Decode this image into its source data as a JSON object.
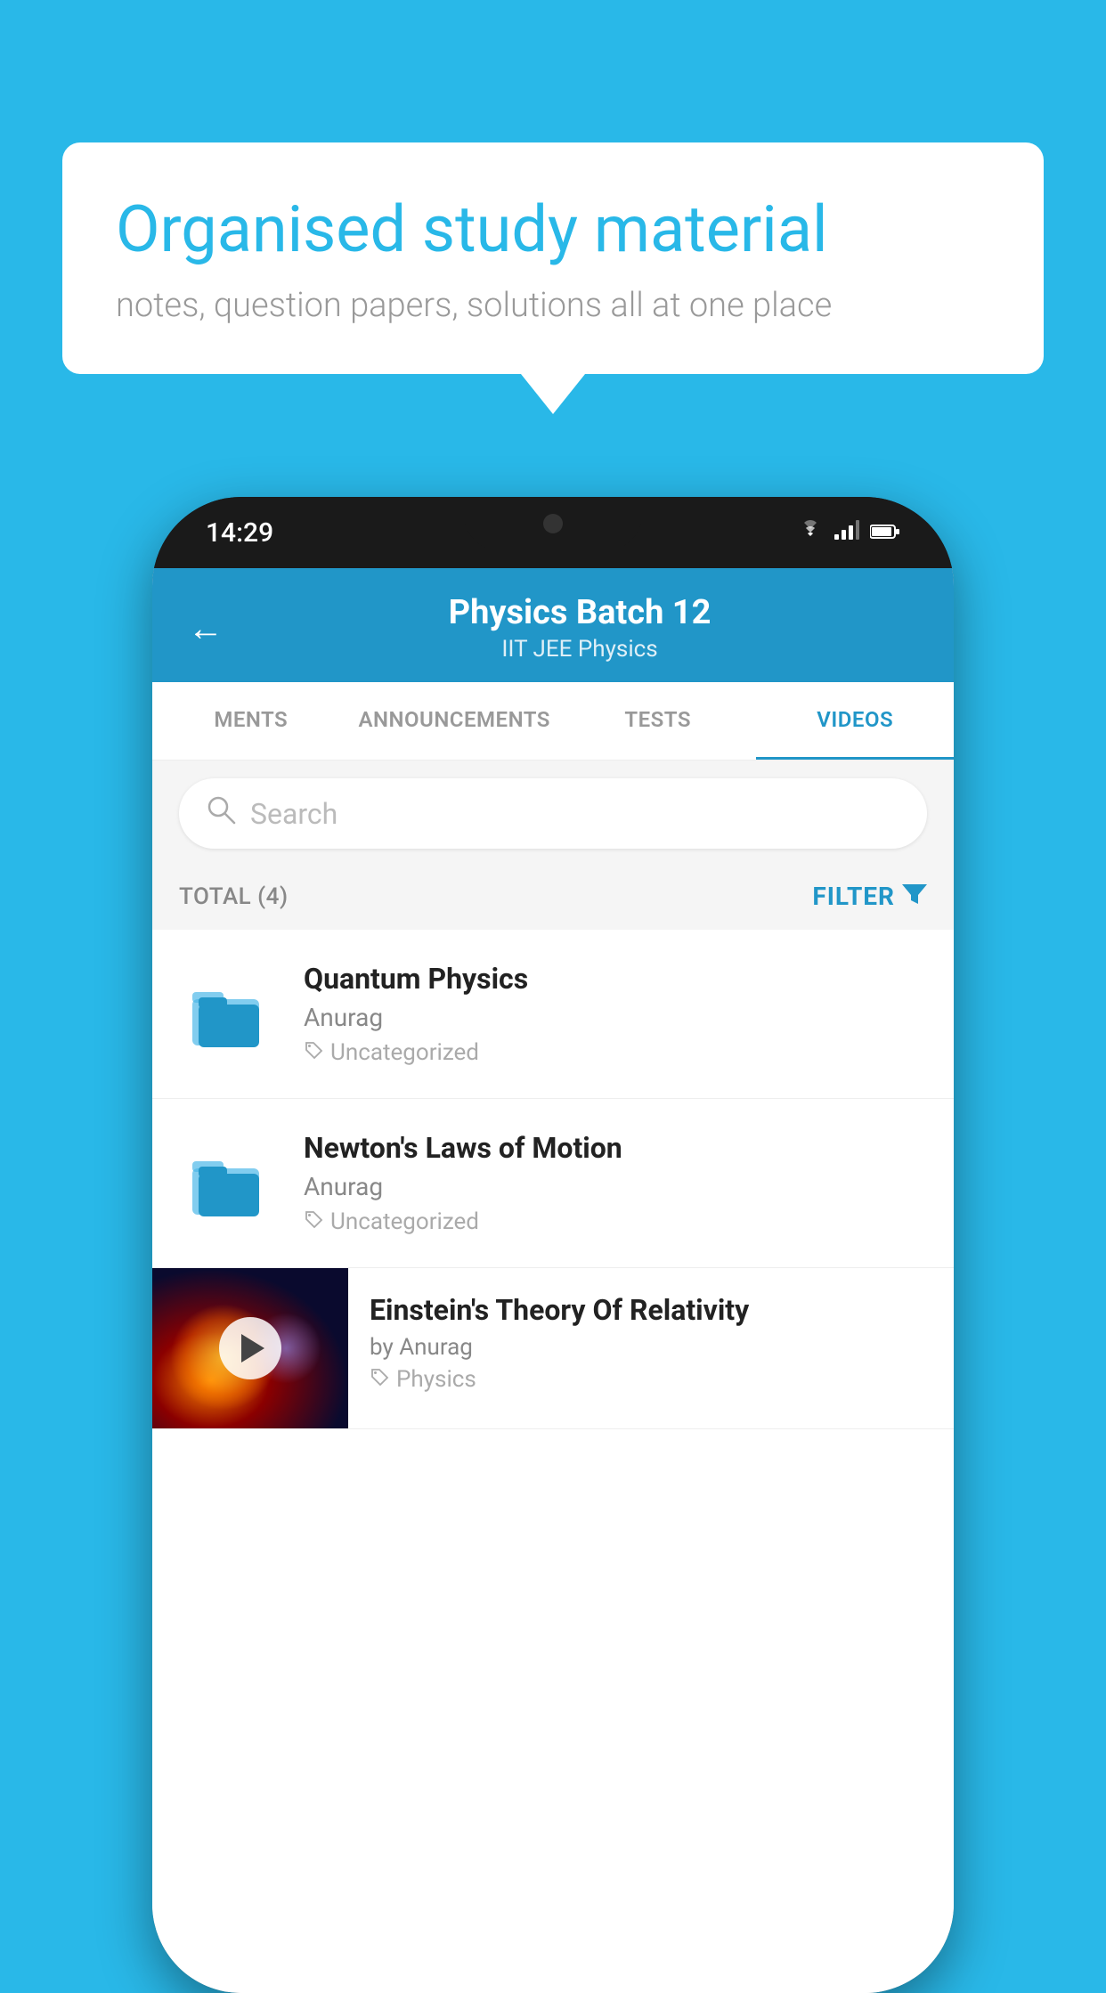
{
  "background": {
    "color": "#29b8e8"
  },
  "speech_bubble": {
    "heading": "Organised study material",
    "subtext": "notes, question papers, solutions all at one place"
  },
  "phone": {
    "status_bar": {
      "time": "14:29",
      "icons": [
        "wifi",
        "signal",
        "battery"
      ]
    },
    "header": {
      "title": "Physics Batch 12",
      "subtitle": "IIT JEE   Physics",
      "back_label": "←"
    },
    "tabs": [
      {
        "label": "MENTS",
        "active": false
      },
      {
        "label": "ANNOUNCEMENTS",
        "active": false
      },
      {
        "label": "TESTS",
        "active": false
      },
      {
        "label": "VIDEOS",
        "active": true
      }
    ],
    "search": {
      "placeholder": "Search"
    },
    "filter_row": {
      "total_label": "TOTAL (4)",
      "filter_label": "FILTER"
    },
    "videos": [
      {
        "id": "quantum",
        "title": "Quantum Physics",
        "author": "Anurag",
        "tag": "Uncategorized",
        "type": "folder"
      },
      {
        "id": "newton",
        "title": "Newton's Laws of Motion",
        "author": "Anurag",
        "tag": "Uncategorized",
        "type": "folder"
      },
      {
        "id": "einstein",
        "title": "Einstein's Theory Of Relativity",
        "author": "by Anurag",
        "tag": "Physics",
        "type": "video"
      }
    ]
  }
}
